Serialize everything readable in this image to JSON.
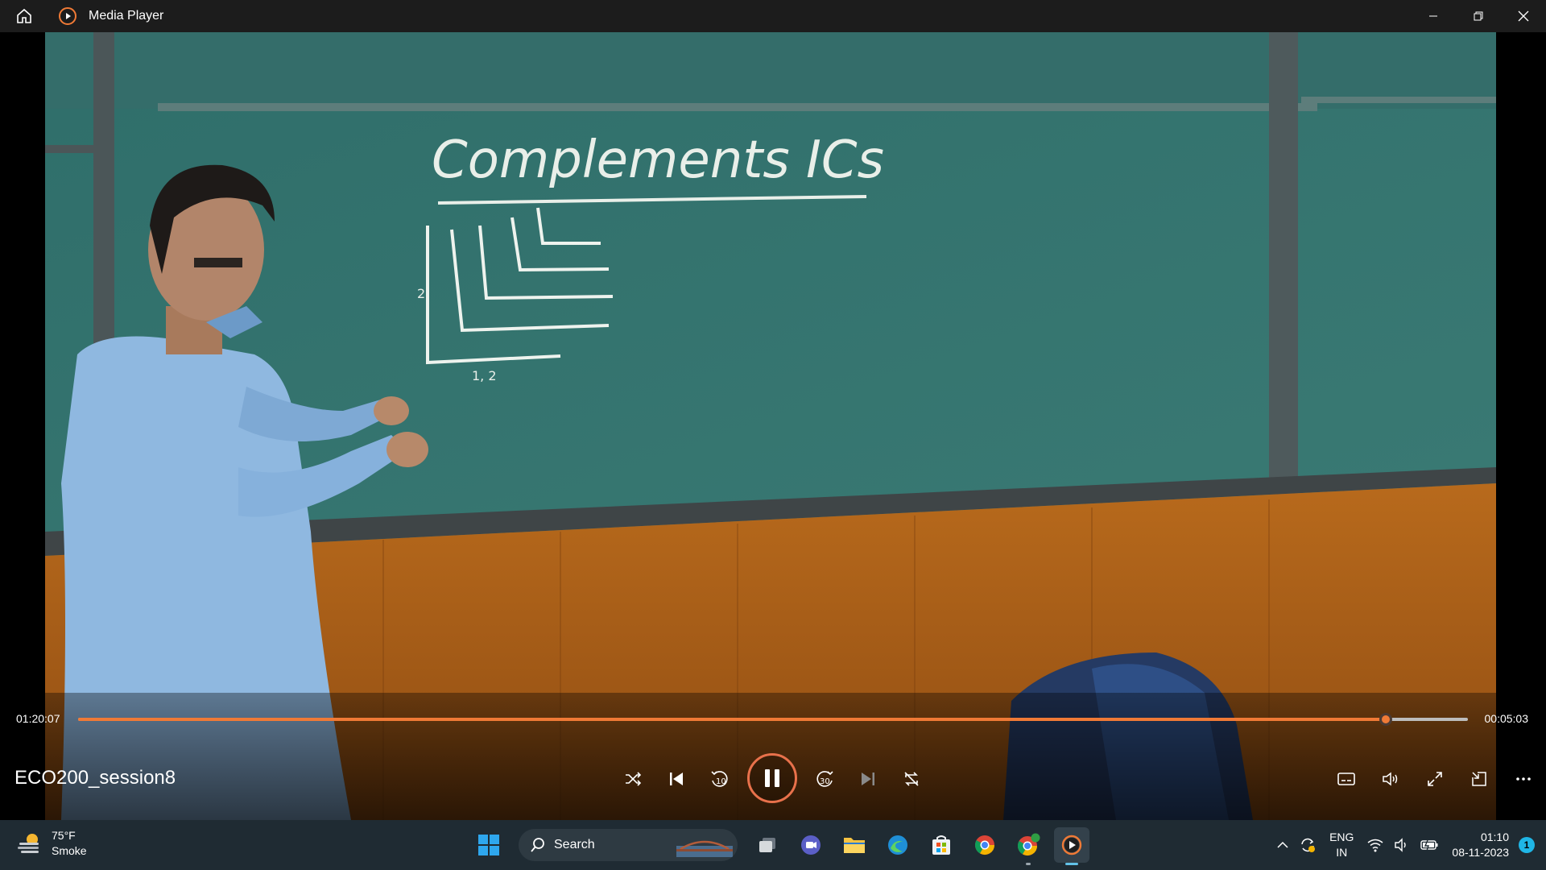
{
  "window": {
    "title": "Media Player"
  },
  "video": {
    "board_heading": "Complements ICs",
    "graph_label_y": "2",
    "graph_label_x": "1, 2"
  },
  "player": {
    "elapsed": "01:20:07",
    "remaining": "00:05:03",
    "progress_fraction": 0.941,
    "media_title": "ECO200_session8",
    "accent_color": "#f07a36",
    "skip_back_seconds": "10",
    "skip_forward_seconds": "30"
  },
  "taskbar": {
    "weather_temp": "75°F",
    "weather_desc": "Smoke",
    "search_label": "Search",
    "apps": [
      "start-icon",
      "search",
      "task-view-icon",
      "teams-icon",
      "file-explorer-icon",
      "edge-icon",
      "store-icon",
      "chrome-icon",
      "chrome-profile-icon",
      "media-player-icon"
    ],
    "language": "ENG",
    "region": "IN",
    "time": "01:10",
    "date": "08-11-2023",
    "notification_count": "1"
  }
}
